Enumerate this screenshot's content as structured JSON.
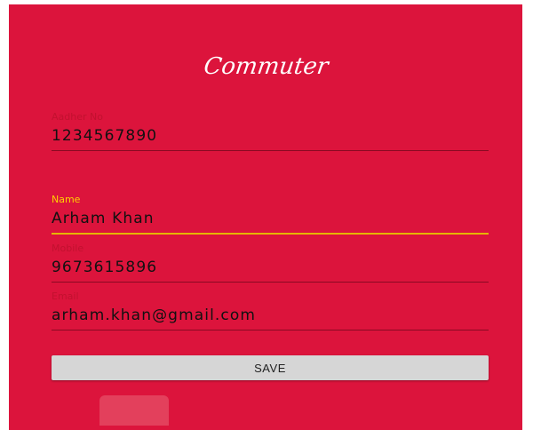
{
  "app": {
    "logo_text": "Commuter"
  },
  "form": {
    "aadhar": {
      "label": "Aadher No",
      "value": "1234567890"
    },
    "name": {
      "label": "Name",
      "value": "Arham Khan"
    },
    "mobile": {
      "label": "Mobile",
      "value": "9673615896"
    },
    "email": {
      "label": "Email",
      "value": "arham.khan@gmail.com"
    }
  },
  "actions": {
    "save_label": "SAVE"
  },
  "colors": {
    "background": "#dc143c",
    "focus_accent": "#ffd000",
    "button": "#d6d6d6"
  }
}
